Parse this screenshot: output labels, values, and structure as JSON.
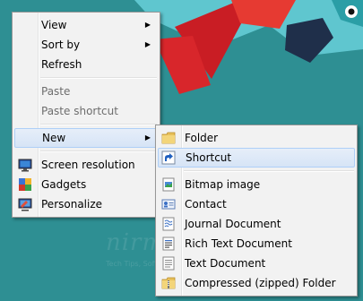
{
  "watermark": {
    "name": "nirmaltv",
    "tagline": "Tech Tips, Software, Web, Windows, Audio and Internet"
  },
  "context_menu": {
    "items": [
      {
        "label": "View",
        "submenu": true
      },
      {
        "label": "Sort by",
        "submenu": true
      },
      {
        "label": "Refresh"
      },
      {
        "label": "Paste",
        "disabled": true
      },
      {
        "label": "Paste shortcut",
        "disabled": true
      },
      {
        "label": "New",
        "submenu": true,
        "highlighted": true
      },
      {
        "label": "Screen resolution",
        "icon": "screen-resolution-icon"
      },
      {
        "label": "Gadgets",
        "icon": "gadgets-icon"
      },
      {
        "label": "Personalize",
        "icon": "personalize-icon"
      }
    ]
  },
  "new_submenu": {
    "items": [
      {
        "label": "Folder",
        "icon": "folder-icon"
      },
      {
        "label": "Shortcut",
        "icon": "shortcut-icon",
        "highlighted": true
      },
      {
        "label": "Bitmap image",
        "icon": "bitmap-icon"
      },
      {
        "label": "Contact",
        "icon": "contact-icon"
      },
      {
        "label": "Journal Document",
        "icon": "journal-icon"
      },
      {
        "label": "Rich Text Document",
        "icon": "rich-text-icon"
      },
      {
        "label": "Text Document",
        "icon": "text-document-icon"
      },
      {
        "label": "Compressed (zipped) Folder",
        "icon": "zipped-folder-icon"
      }
    ]
  },
  "colors": {
    "desktop": "#2e8f93",
    "menu_bg": "#f2f2f2",
    "highlight": "#d6e4f6"
  }
}
